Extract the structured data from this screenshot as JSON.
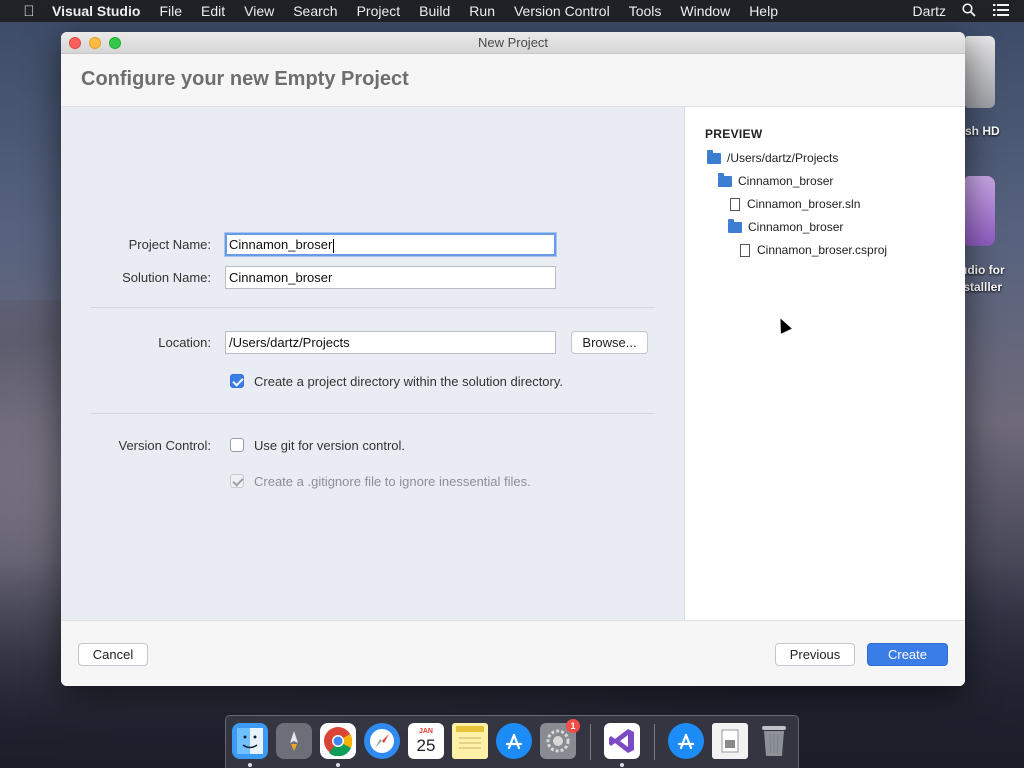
{
  "menubar": {
    "app_name": "Visual Studio",
    "items": [
      "File",
      "Edit",
      "View",
      "Search",
      "Project",
      "Build",
      "Run",
      "Version Control",
      "Tools",
      "Window",
      "Help"
    ],
    "user": "Dartz"
  },
  "desktop": {
    "hd_label": "sh HD",
    "installer_label": "udio for\n stalller"
  },
  "window": {
    "title": "New Project",
    "heading": "Configure your new Empty Project"
  },
  "form": {
    "project_name_label": "Project Name:",
    "project_name_value": "Cinnamon_broser",
    "solution_name_label": "Solution Name:",
    "solution_name_value": "Cinnamon_broser",
    "location_label": "Location:",
    "location_value": "/Users/dartz/Projects",
    "browse_label": "Browse...",
    "create_dir_label": "Create a project directory within the solution directory.",
    "create_dir_checked": true,
    "version_control_label": "Version Control:",
    "use_git_label": "Use git for version control.",
    "use_git_checked": false,
    "gitignore_label": "Create a .gitignore file to ignore inessential files.",
    "gitignore_checked": true,
    "gitignore_enabled": false
  },
  "preview": {
    "title": "PREVIEW",
    "tree": [
      {
        "type": "folder",
        "name": "/Users/dartz/Projects",
        "depth": 0
      },
      {
        "type": "folder",
        "name": "Cinnamon_broser",
        "depth": 1
      },
      {
        "type": "file",
        "name": "Cinnamon_broser.sln",
        "depth": 2
      },
      {
        "type": "folder",
        "name": "Cinnamon_broser",
        "depth": 2
      },
      {
        "type": "file",
        "name": "Cinnamon_broser.csproj",
        "depth": 3
      }
    ]
  },
  "footer": {
    "cancel_label": "Cancel",
    "previous_label": "Previous",
    "create_label": "Create"
  },
  "dock": {
    "calendar_month": "JAN",
    "calendar_day": "25",
    "settings_badge": "1",
    "colors": {
      "finder": "#3d9af3",
      "launchpad": "#6c6f78",
      "safari": "#2f8bf0",
      "appstore": "#1c8cf6",
      "visualstudio": "#7a4bc2"
    }
  }
}
